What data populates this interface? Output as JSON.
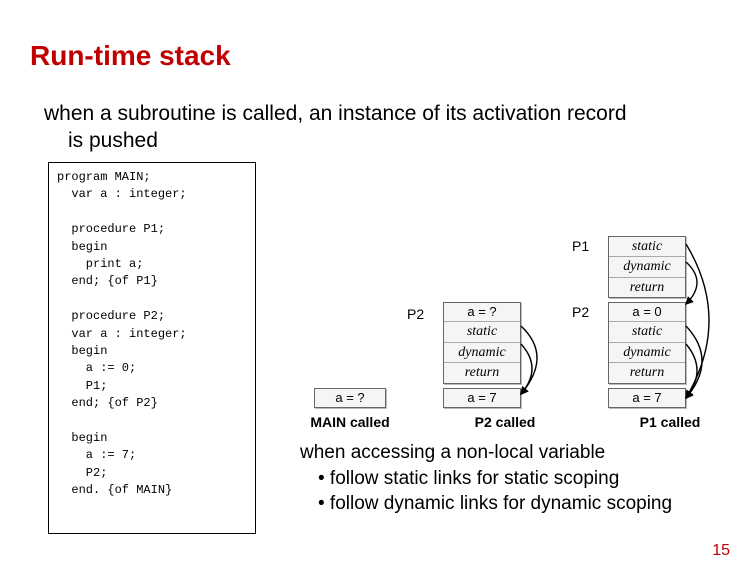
{
  "title": "Run-time stack",
  "intro_line1": "when a subroutine is called, an instance of its activation record",
  "intro_line2": "is pushed",
  "code": "program MAIN;\n  var a : integer;\n\n  procedure P1;\n  begin\n    print a;\n  end; {of P1}\n\n  procedure P2;\n  var a : integer;\n  begin\n    a := 0;\n    P1;\n  end; {of P2}\n\n  begin\n    a := 7;\n    P2;\n  end. {of MAIN}",
  "stacks": {
    "col1": {
      "frame1": {
        "cell": "a = ?"
      },
      "caption": "MAIN called"
    },
    "col2": {
      "label_top": "P2",
      "frame_top": {
        "c1": "a = ?",
        "c2": "static",
        "c3": "dynamic",
        "c4": "return"
      },
      "frame_bot": {
        "cell": "a = 7"
      },
      "caption": "P2 called"
    },
    "col3": {
      "label_a": "P1",
      "label_b": "P2",
      "frame_a": {
        "c1": "static",
        "c2": "dynamic",
        "c3": "return"
      },
      "frame_b": {
        "c1": "a = 0",
        "c2": "static",
        "c3": "dynamic",
        "c4": "return"
      },
      "frame_bot": {
        "cell": "a = 7"
      },
      "caption": "P1 called"
    }
  },
  "notes": {
    "line1": "when accessing a non-local variable",
    "bullet1": "• follow static links for static scoping",
    "bullet2": "• follow dynamic links for dynamic scoping"
  },
  "slide_number": "15"
}
